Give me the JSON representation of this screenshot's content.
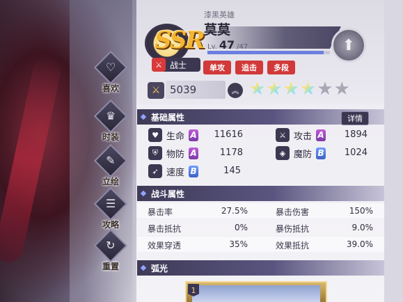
{
  "menu": [
    {
      "label": "喜欢",
      "icon": "heart-icon"
    },
    {
      "label": "时装",
      "icon": "costume-icon"
    },
    {
      "label": "立绘",
      "icon": "portrait-icon"
    },
    {
      "label": "攻略",
      "icon": "guide-book-icon"
    },
    {
      "label": "重置",
      "icon": "reset-icon"
    }
  ],
  "hero": {
    "rarity": "SSR",
    "subtitle": "漆黑英雄",
    "name": "莫莫",
    "lv_prefix": "Lv.",
    "level": "47",
    "level_max": "/47",
    "exp_fraction": 0.95,
    "class_label": "战士",
    "tags": [
      "单攻",
      "追击",
      "多段"
    ],
    "power": "5039",
    "stars_total": 6,
    "stars_on": 4
  },
  "basic": {
    "title": "基础属性",
    "detail_label": "详情",
    "stats": [
      {
        "label": "生命",
        "grade": "A",
        "value": "11616",
        "icon": "heart-icon"
      },
      {
        "label": "攻击",
        "grade": "A",
        "value": "1894",
        "icon": "sword-icon"
      },
      {
        "label": "物防",
        "grade": "A",
        "value": "1178",
        "icon": "shield-icon"
      },
      {
        "label": "魔防",
        "grade": "B",
        "value": "1024",
        "icon": "magic-shield-icon"
      },
      {
        "label": "速度",
        "grade": "B",
        "value": "145",
        "icon": "boot-icon"
      }
    ]
  },
  "combat": {
    "title": "战斗属性",
    "stats": [
      {
        "label": "暴击率",
        "value": "27.5%"
      },
      {
        "label": "暴击伤害",
        "value": "150%"
      },
      {
        "label": "暴击抵抗",
        "value": "0%"
      },
      {
        "label": "暴伤抵抗",
        "value": "9.0%"
      },
      {
        "label": "效果穿透",
        "value": "35%"
      },
      {
        "label": "效果抵抗",
        "value": "39.0%"
      }
    ]
  },
  "arc": {
    "title": "弧光",
    "card_number": "1"
  },
  "colors": {
    "accent_red": "#d2393a",
    "section_dark": "#3e3a56",
    "grade_A": "#9b48c4",
    "grade_B": "#4f78e0"
  }
}
